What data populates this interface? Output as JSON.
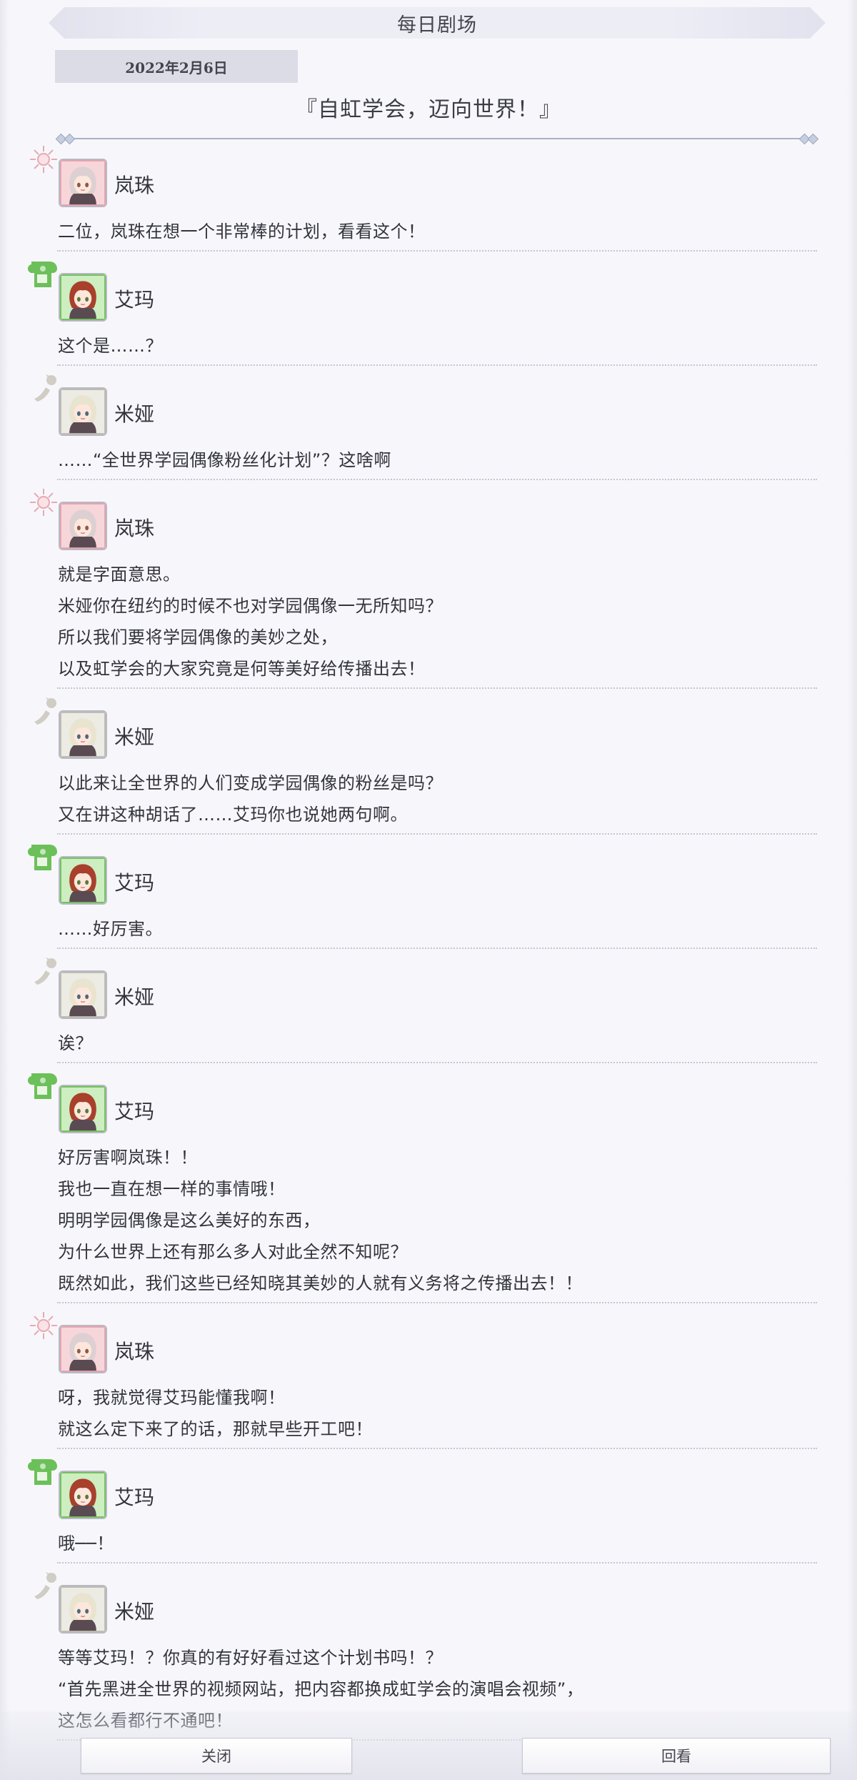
{
  "header": {
    "title": "每日剧场",
    "date": "2022年2月6日",
    "story_title": "『自虹学会，迈向世界！』"
  },
  "colors": {
    "lanzhu": "#f2b8c0",
    "aima": "#7ac86a",
    "miya": "#d5d2c8"
  },
  "dialogue": [
    {
      "character": "lanzhu",
      "speaker": "岚珠",
      "lines": [
        "二位，岚珠在想一个非常棒的计划，看看这个！"
      ]
    },
    {
      "character": "aima",
      "speaker": "艾玛",
      "lines": [
        "这个是……？"
      ]
    },
    {
      "character": "miya",
      "speaker": "米娅",
      "lines": [
        "……“全世界学园偶像粉丝化计划”？这啥啊"
      ]
    },
    {
      "character": "lanzhu",
      "speaker": "岚珠",
      "lines": [
        "就是字面意思。",
        "米娅你在纽约的时候不也对学园偶像一无所知吗？",
        "所以我们要将学园偶像的美妙之处，",
        "以及虹学会的大家究竟是何等美好给传播出去！"
      ]
    },
    {
      "character": "miya",
      "speaker": "米娅",
      "lines": [
        "以此来让全世界的人们变成学园偶像的粉丝是吗？",
        "又在讲这种胡话了……艾玛你也说她两句啊。"
      ]
    },
    {
      "character": "aima",
      "speaker": "艾玛",
      "lines": [
        "……好厉害。"
      ]
    },
    {
      "character": "miya",
      "speaker": "米娅",
      "lines": [
        "诶？"
      ]
    },
    {
      "character": "aima",
      "speaker": "艾玛",
      "lines": [
        "好厉害啊岚珠！！",
        "我也一直在想一样的事情哦！",
        "明明学园偶像是这么美好的东西，",
        "为什么世界上还有那么多人对此全然不知呢？",
        "既然如此，我们这些已经知晓其美妙的人就有义务将之传播出去！！"
      ]
    },
    {
      "character": "lanzhu",
      "speaker": "岚珠",
      "lines": [
        "呀，我就觉得艾玛能懂我啊！",
        "就这么定下来了的话，那就早些开工吧！"
      ]
    },
    {
      "character": "aima",
      "speaker": "艾玛",
      "lines": [
        "哦──！"
      ]
    },
    {
      "character": "miya",
      "speaker": "米娅",
      "lines": [
        "等等艾玛！？你真的有好好看过这个计划书吗！？",
        "“首先黑进全世界的视频网站，把内容都换成虹学会的演唱会视频”，",
        "这怎么看都行不通吧！"
      ]
    }
  ],
  "buttons": {
    "close_label": "关闭",
    "review_label": "回看"
  }
}
